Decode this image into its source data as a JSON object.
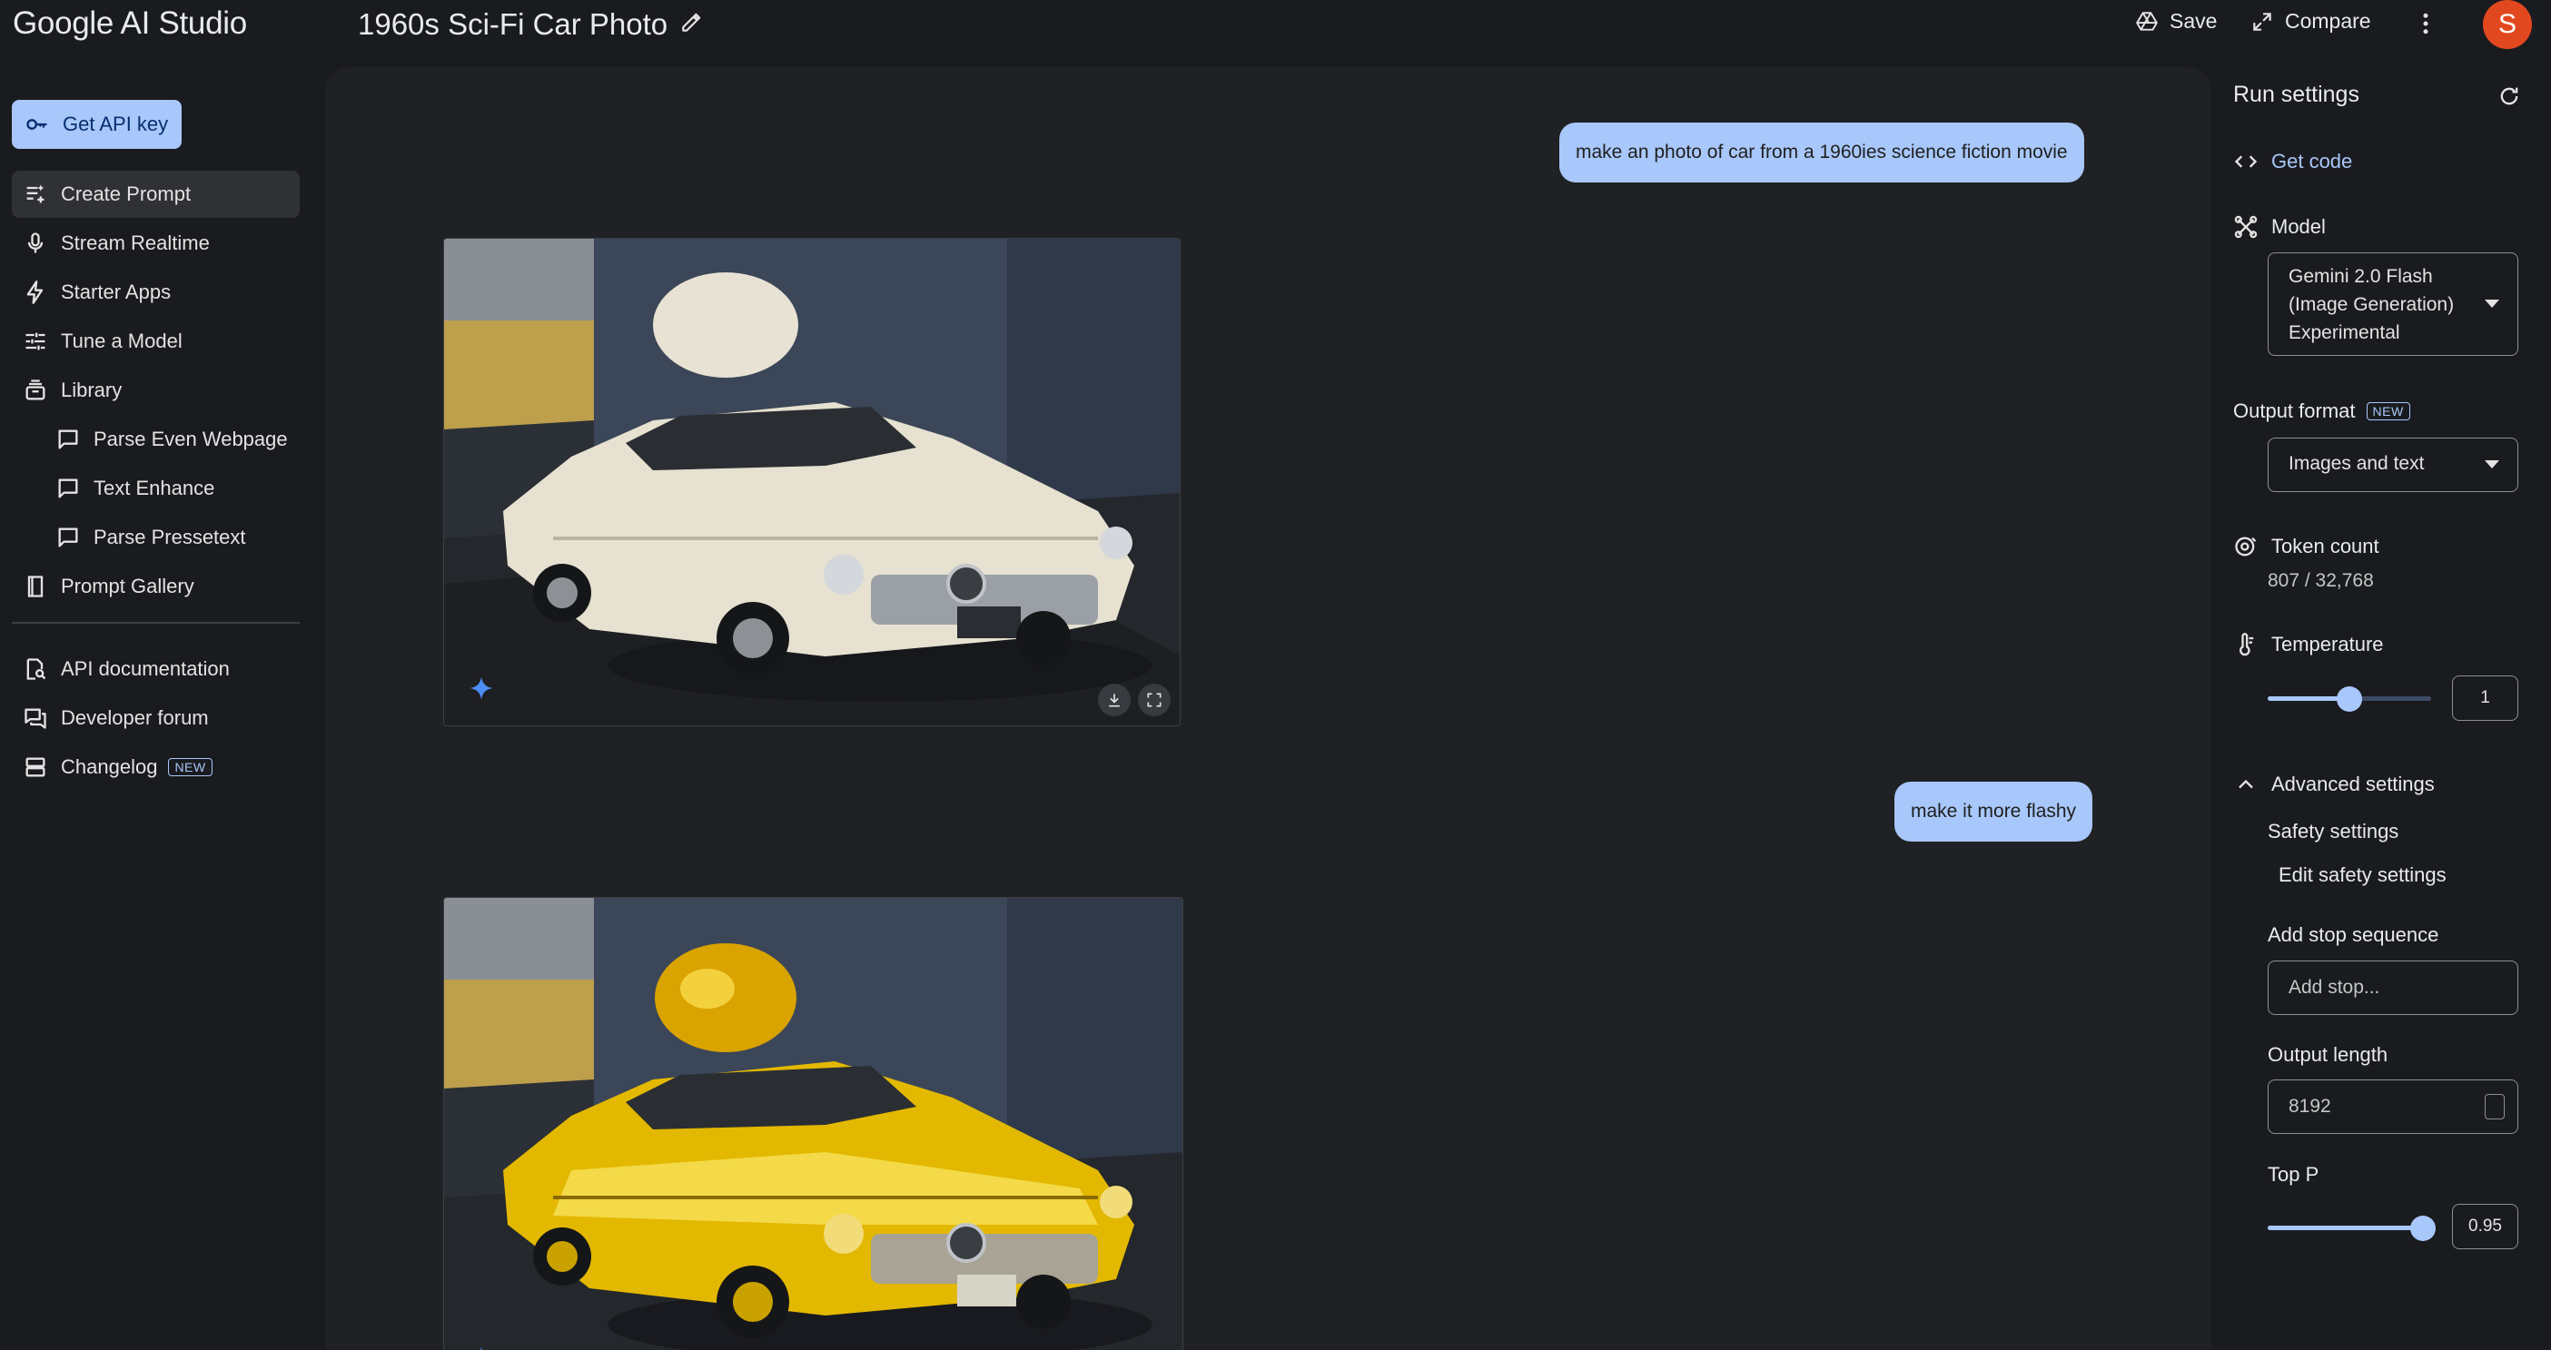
{
  "app": {
    "brand": "Google AI Studio",
    "doc_title": "1960s Sci-Fi Car Photo",
    "save_label": "Save",
    "compare_label": "Compare",
    "avatar_initial": "S"
  },
  "sidebar": {
    "api_key_label": "Get API key",
    "items": [
      {
        "label": "Create Prompt",
        "icon": "create-prompt-icon"
      },
      {
        "label": "Stream Realtime",
        "icon": "microphone-icon"
      },
      {
        "label": "Starter Apps",
        "icon": "bolt-icon"
      },
      {
        "label": "Tune a Model",
        "icon": "tune-icon"
      },
      {
        "label": "Library",
        "icon": "library-icon"
      },
      {
        "label": "Parse Even Webpage",
        "icon": "chat-icon"
      },
      {
        "label": "Text Enhance",
        "icon": "chat-icon"
      },
      {
        "label": "Parse Pressetext",
        "icon": "chat-icon"
      },
      {
        "label": "Prompt Gallery",
        "icon": "book-icon"
      },
      {
        "label": "API documentation",
        "icon": "doc-search-icon"
      },
      {
        "label": "Developer forum",
        "icon": "forum-icon"
      },
      {
        "label": "Changelog",
        "icon": "changelog-icon",
        "badge": "NEW"
      }
    ]
  },
  "chat": {
    "messages": [
      {
        "role": "user",
        "text": "make an photo of car from a 1960ies science fiction movie"
      },
      {
        "role": "model",
        "type": "image",
        "subject": "white retro sci-fi car"
      },
      {
        "role": "user",
        "text": "make it more flashy"
      },
      {
        "role": "model",
        "type": "image",
        "subject": "gold chrome retro sci-fi car"
      }
    ]
  },
  "run_settings": {
    "title": "Run settings",
    "get_code_label": "Get code",
    "model_label": "Model",
    "model_value": "Gemini 2.0 Flash (Image Generation) Experimental",
    "output_format_label": "Output format",
    "output_format_badge": "NEW",
    "output_format_value": "Images and text",
    "token_count_label": "Token count",
    "token_count_value": "807 / 32,768",
    "temperature_label": "Temperature",
    "temperature_value": "1",
    "temperature_fraction": 0.5,
    "advanced_label": "Advanced settings",
    "safety_label": "Safety settings",
    "edit_safety_label": "Edit safety settings",
    "stop_sequence_label": "Add stop sequence",
    "stop_sequence_placeholder": "Add stop...",
    "output_length_label": "Output length",
    "output_length_value": "8192",
    "top_p_label": "Top P",
    "top_p_value": "0.95",
    "top_p_fraction": 0.95
  },
  "colors": {
    "accent": "#a8c7fa",
    "background": "#1a1b1e",
    "avatar": "#e2481f"
  }
}
